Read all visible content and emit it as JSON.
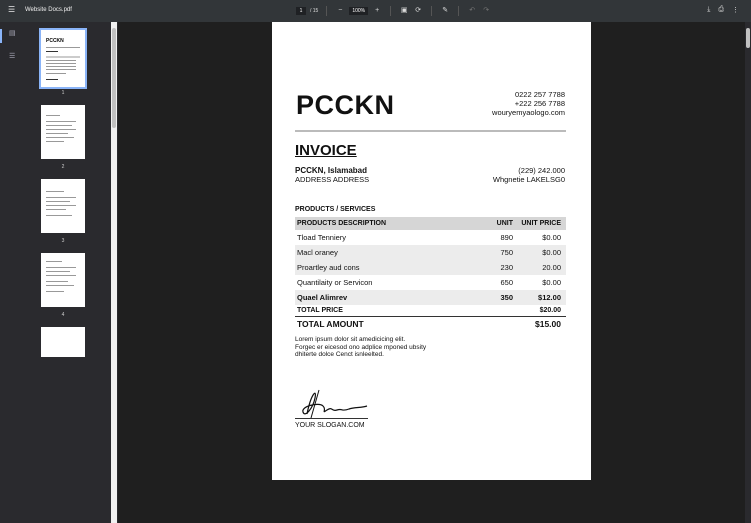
{
  "app": {
    "file_name": "Website Docs.pdf",
    "current_page": "1",
    "total_pages": "/ 15",
    "zoom": "100%"
  },
  "toolbar_icons": {
    "menu": "hamburger-icon",
    "zoom_out": "minus-icon",
    "zoom_in": "plus-icon",
    "fit": "fit-page-icon",
    "rotate": "rotate-icon",
    "draw": "pen-icon",
    "undo": "undo-icon",
    "redo": "redo-icon",
    "download": "download-icon",
    "print": "print-icon",
    "more": "more-vertical-icon"
  },
  "thumbnails": [
    {
      "label": "1",
      "selected": true
    },
    {
      "label": "2",
      "selected": false
    },
    {
      "label": "3",
      "selected": false
    },
    {
      "label": "4",
      "selected": false
    },
    {
      "label": "",
      "selected": false
    }
  ],
  "invoice": {
    "brand": "PCCKN",
    "contact": [
      "0222 257 7788",
      "+222 256 7788",
      "wouryemyaologo.com"
    ],
    "title": "INVOICE",
    "customer_name": "PCCKN, Islamabad",
    "customer_address": "ADDRESS ADDRESS",
    "right_line1": "(229) 242.000",
    "right_line2": "Whgnetie LAKELSG0",
    "section": "PRODUCTS / SERVICES",
    "columns": [
      "PRODUCTS DESCRIPTION",
      "UNIT",
      "UNIT PRICE"
    ],
    "rows": [
      {
        "desc": "Tload Tenniery",
        "unit": "890",
        "price": "$0.00",
        "shade": false,
        "bold": false
      },
      {
        "desc": "Macl oraney",
        "unit": "750",
        "price": "$0.00",
        "shade": true,
        "bold": false
      },
      {
        "desc": "Proartley aud cons",
        "unit": "230",
        "price": "20.00",
        "shade": true,
        "bold": false
      },
      {
        "desc": "Quantilaity or Servicon",
        "unit": "650",
        "price": "$0.00",
        "shade": false,
        "bold": false
      },
      {
        "desc": "Quael Alimrev",
        "unit": "350",
        "price": "$12.00",
        "shade": true,
        "bold": true
      }
    ],
    "total_price_label": "TOTAL PRICE",
    "total_price_value": "$20.00",
    "total_amount_label": "TOTAL AMOUNT",
    "total_amount_value": "$15.00",
    "note_lines": [
      "Lorem ipsum dolor sit amedicicing elit.",
      "Forgec er eicesod ono adplice mponed ubsity",
      "dhiterte dolce Cenct isnleelted."
    ],
    "slogan": "YOUR SLOGAN.COM"
  }
}
